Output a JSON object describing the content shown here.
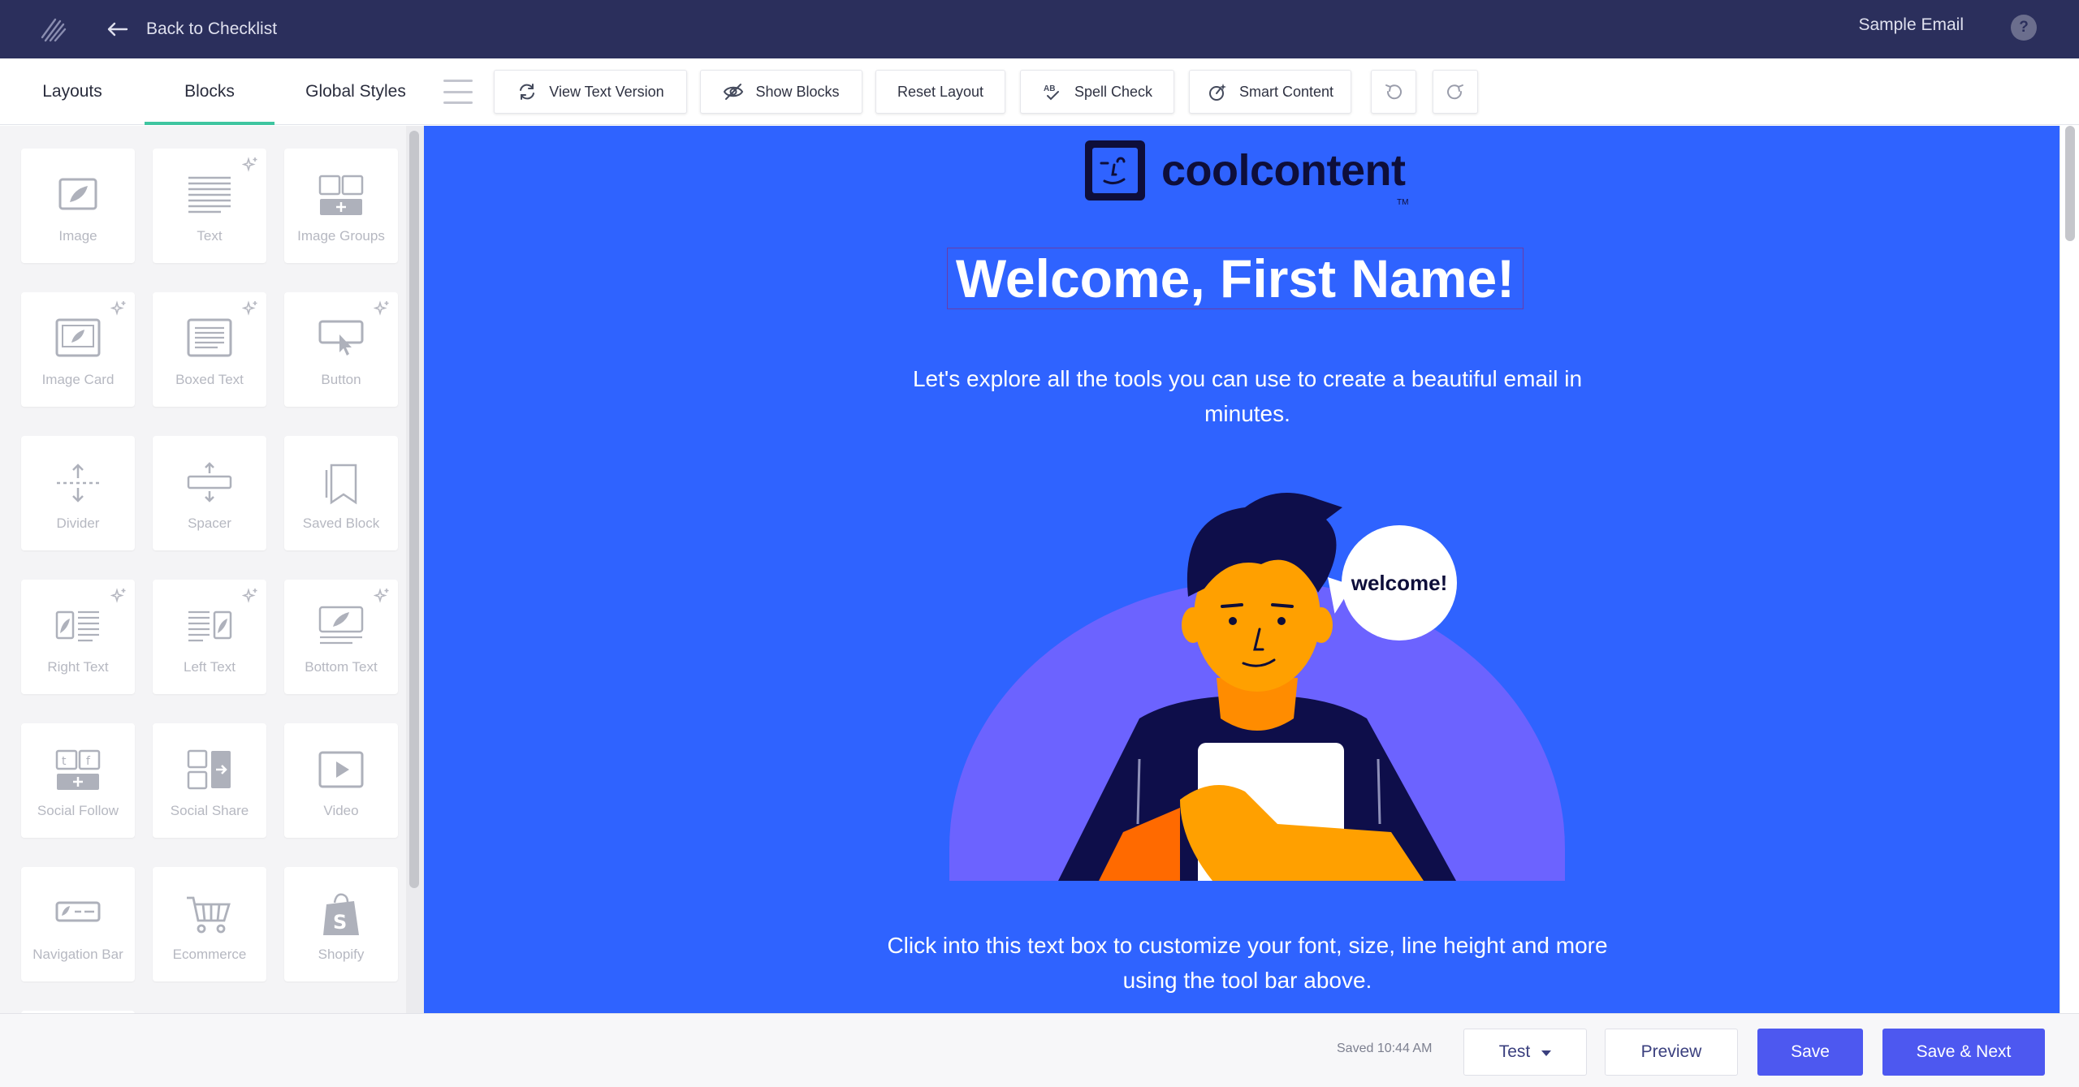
{
  "header": {
    "back_label": "Back to Checklist",
    "document_name": "Sample Email",
    "help_label": "?"
  },
  "tabs": [
    {
      "label": "Layouts",
      "active": false
    },
    {
      "label": "Blocks",
      "active": true
    },
    {
      "label": "Global Styles",
      "active": false
    }
  ],
  "toolbar": {
    "view_text_version": "View Text Version",
    "show_blocks": "Show Blocks",
    "reset_layout": "Reset Layout",
    "spell_check": "Spell Check",
    "smart_content": "Smart Content",
    "spell_check_icon_text": "AB"
  },
  "blocks": [
    {
      "label": "Image",
      "icon": "image-icon",
      "sparkle": false
    },
    {
      "label": "Text",
      "icon": "text-icon",
      "sparkle": true
    },
    {
      "label": "Image Groups",
      "icon": "image-groups-icon",
      "sparkle": false
    },
    {
      "label": "Image Card",
      "icon": "image-card-icon",
      "sparkle": true
    },
    {
      "label": "Boxed Text",
      "icon": "boxed-text-icon",
      "sparkle": true
    },
    {
      "label": "Button",
      "icon": "button-icon",
      "sparkle": true
    },
    {
      "label": "Divider",
      "icon": "divider-icon",
      "sparkle": false
    },
    {
      "label": "Spacer",
      "icon": "spacer-icon",
      "sparkle": false
    },
    {
      "label": "Saved Block",
      "icon": "saved-block-icon",
      "sparkle": false
    },
    {
      "label": "Right Text",
      "icon": "right-text-icon",
      "sparkle": true
    },
    {
      "label": "Left Text",
      "icon": "left-text-icon",
      "sparkle": true
    },
    {
      "label": "Bottom Text",
      "icon": "bottom-text-icon",
      "sparkle": true
    },
    {
      "label": "Social Follow",
      "icon": "social-follow-icon",
      "sparkle": false
    },
    {
      "label": "Social Share",
      "icon": "social-share-icon",
      "sparkle": false
    },
    {
      "label": "Video",
      "icon": "video-icon",
      "sparkle": false
    },
    {
      "label": "Navigation Bar",
      "icon": "navigation-bar-icon",
      "sparkle": false
    },
    {
      "label": "Ecommerce",
      "icon": "ecommerce-icon",
      "sparkle": false
    },
    {
      "label": "Shopify",
      "icon": "shopify-icon",
      "sparkle": false
    }
  ],
  "email": {
    "brand_name": "coolcontent",
    "brand_tm": "TM",
    "headline": "Welcome, First Name!",
    "intro": "Let's explore all the tools you can use to create a beautiful email in minutes.",
    "bubble_text": "welcome!",
    "outro": "Click into this text box to customize your font, size, line height and more using the tool bar above.",
    "background_color": "#2f63ff"
  },
  "footer": {
    "saved_status": "Saved 10:44 AM",
    "test_label": "Test",
    "preview_label": "Preview",
    "save_label": "Save",
    "save_next_label": "Save & Next"
  },
  "colors": {
    "topbar": "#2b2f5c",
    "accent_tab": "#3ec5a0",
    "primary_button": "#4d58f0",
    "canvas": "#2f63ff"
  }
}
